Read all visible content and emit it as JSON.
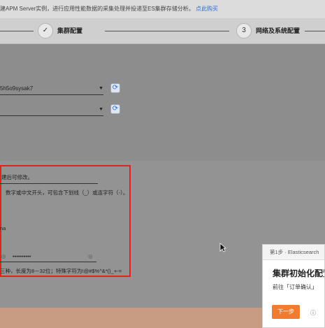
{
  "notice": {
    "text": "建APM Server实例，进行应用性能数据的采集处理并投递至ES集群存储分析。",
    "link": "点此购买"
  },
  "steps": [
    {
      "label": "集群配置",
      "mark": "✓"
    },
    {
      "label": "网络及系统配置",
      "mark": "3"
    }
  ],
  "network": {
    "vpc_value": "5h5o9sysak7",
    "subnet_value": ""
  },
  "system": {
    "name_hint": "建后可修改。",
    "name_rule": "数字或中文开头，可包含下划线（_）或连字符（-）。",
    "fragment": "na",
    "password_mask": "••••••••••",
    "password_rule": "三种，长度为8－32位；特殊字符为!@#$%^&*()_+-="
  },
  "popup": {
    "step": "第1步 · Elasticsearch",
    "title": "集群初始化配置",
    "desc": "前往「订单确认」",
    "next_label": "下一步"
  },
  "colors": {
    "highlight_border": "#e2231a",
    "primary_button": "#f07d2f",
    "link": "#2f6fd1"
  }
}
